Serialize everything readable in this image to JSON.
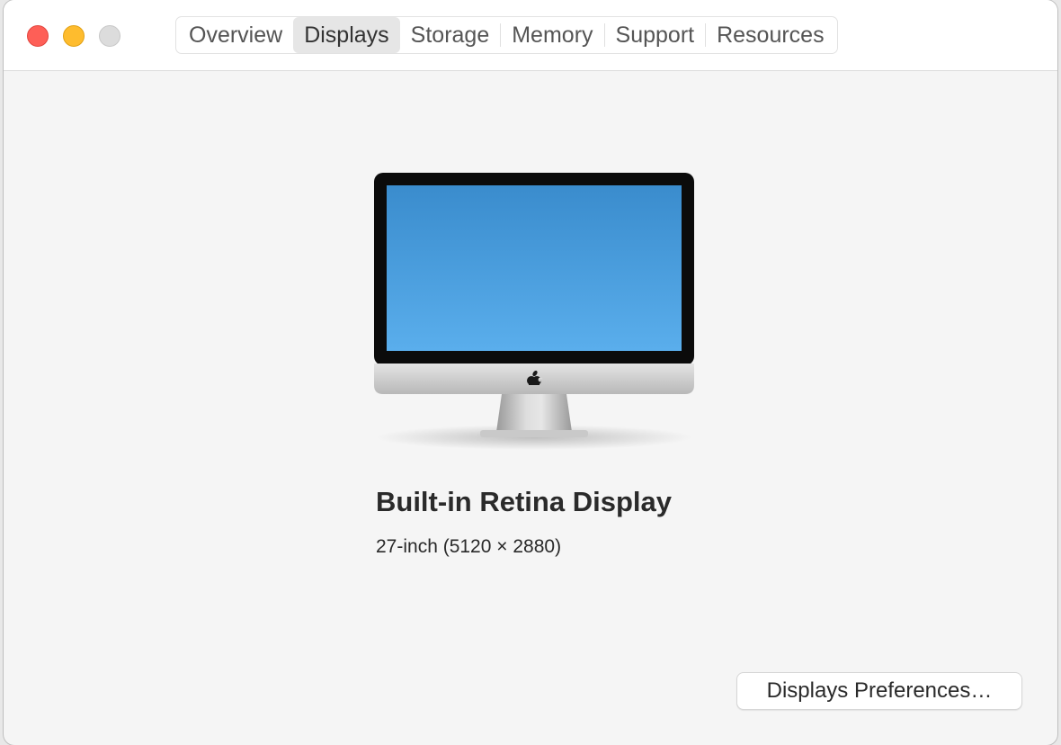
{
  "window": {
    "controls": {
      "close": "close-button",
      "minimize": "minimize-button",
      "zoom": "zoom-button"
    }
  },
  "tabs": [
    {
      "label": "Overview",
      "selected": false
    },
    {
      "label": "Displays",
      "selected": true
    },
    {
      "label": "Storage",
      "selected": false
    },
    {
      "label": "Memory",
      "selected": false
    },
    {
      "label": "Support",
      "selected": false
    },
    {
      "label": "Resources",
      "selected": false
    }
  ],
  "display": {
    "name": "Built-in Retina Display",
    "spec": "27-inch (5120 × 2880)",
    "icon": "imac-display-icon"
  },
  "actions": {
    "preferences_label": "Displays Preferences…"
  },
  "colors": {
    "close": "#fe5f57",
    "minimize": "#febc2e",
    "zoom": "#dcdcdc",
    "screen_top": "#3a8ccd",
    "screen_bottom": "#5aaeec"
  }
}
